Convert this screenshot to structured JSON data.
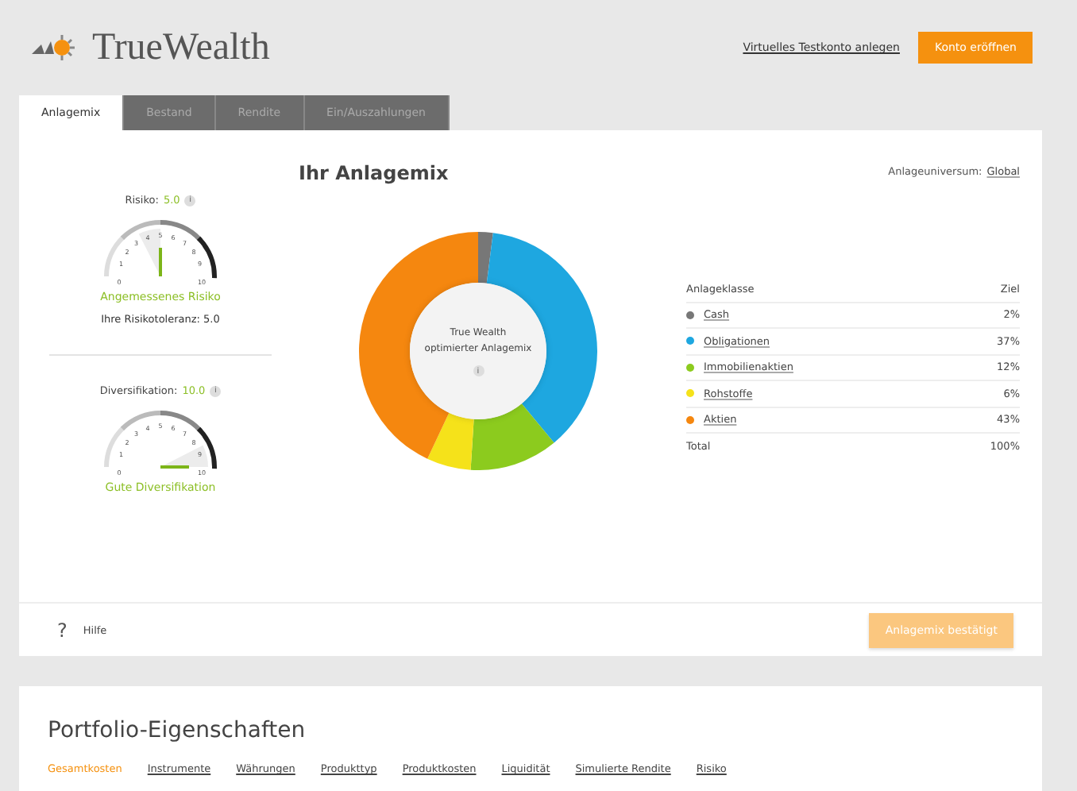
{
  "header": {
    "brand": "TrueWealth",
    "link": "Virtuelles Testkonto anlegen",
    "button": "Konto eröffnen"
  },
  "tabs": [
    {
      "label": "Anlagemix",
      "selected": true
    },
    {
      "label": "Bestand",
      "selected": false
    },
    {
      "label": "Rendite",
      "selected": false
    },
    {
      "label": "Ein/Auszahlungen",
      "selected": false
    }
  ],
  "gauges": [
    {
      "label": "Risiko:",
      "value": "5.0",
      "info_icon": "i",
      "ticks": [
        "0",
        "1",
        "2",
        "3",
        "4",
        "5",
        "6",
        "7",
        "8",
        "9",
        "10"
      ],
      "verdict": "Angemessenes Risiko",
      "note": "Ihre Risikotoleranz: 5.0"
    },
    {
      "label": "Diversifikation:",
      "value": "10.0",
      "info_icon": "i",
      "ticks": [
        "0",
        "1",
        "2",
        "3",
        "4",
        "5",
        "6",
        "7",
        "8",
        "9",
        "10"
      ],
      "verdict": "Gute Diversifikation"
    }
  ],
  "mix": {
    "title": "Ihr Anlagemix",
    "universe_label": "Anlageuniversum:",
    "universe": "Global",
    "center": "True Wealth optimierter Anlagemix",
    "center_icon": "i",
    "chart_data": {
      "type": "donut",
      "series": [
        {
          "values": [
            2,
            37,
            12,
            6,
            43
          ]
        }
      ]
    },
    "table": {
      "columns": [
        "Anlageklasse",
        "Ziel"
      ],
      "rows": [
        {
          "name": "Cash",
          "value": "2%",
          "color": "#777777"
        },
        {
          "name": "Obligationen",
          "value": "37%",
          "color": "#1ea7e0"
        },
        {
          "name": "Immobilienaktien",
          "value": "12%",
          "color": "#8ccb1e"
        },
        {
          "name": "Rohstoffe",
          "value": "6%",
          "color": "#f5e21a"
        },
        {
          "name": "Aktien",
          "value": "43%",
          "color": "#f5870f"
        }
      ],
      "total": {
        "name": "Total",
        "value": "100%"
      }
    }
  },
  "footer": {
    "help_icon": "?",
    "help": "Hilfe",
    "confirm": "Anlagemix bestätigt",
    "confirm_disabled": true
  },
  "properties": {
    "title": "Portfolio-Eigenschaften",
    "tabs": [
      {
        "label": "Gesamtkosten",
        "selected": true
      },
      {
        "label": "Instrumente",
        "selected": false
      },
      {
        "label": "Währungen",
        "selected": false
      },
      {
        "label": "Produkttyp",
        "selected": false
      },
      {
        "label": "Produktkosten",
        "selected": false
      },
      {
        "label": "Liquidität",
        "selected": false
      },
      {
        "label": "Simulierte Rendite",
        "selected": false
      },
      {
        "label": "Risiko",
        "selected": false
      }
    ]
  }
}
